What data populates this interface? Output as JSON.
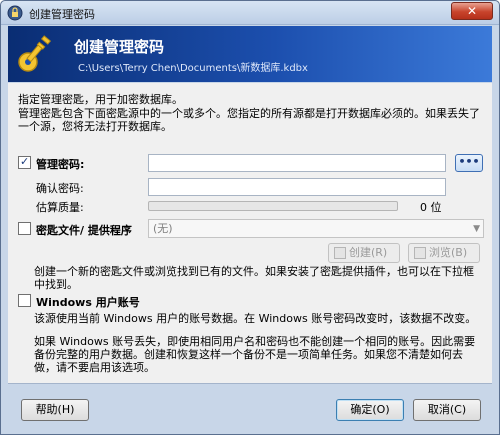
{
  "window": {
    "title": "创建管理密码"
  },
  "banner": {
    "title": "创建管理密码",
    "path": "C:\\Users\\Terry Chen\\Documents\\新数据库.kdbx"
  },
  "intro": {
    "line1": "指定管理密匙，用于加密数据库。",
    "line2": "管理密匙包含下面密匙源中的一个或多个。您指定的所有源都是打开数据库必须的。如果丢失了一个源，您将无法打开数据库。"
  },
  "password": {
    "checked": true,
    "label": "管理密码:",
    "repeat_label": "确认密码:",
    "quality_label": "估算质量:",
    "quality_value": 0,
    "quality_text": "0 位",
    "show_button_label": "•••"
  },
  "keyfile": {
    "checked": false,
    "label": "密匙文件/ 提供程序",
    "select_value": "(无)",
    "create_button": "创建(R)",
    "browse_button": "浏览(B)",
    "description": "创建一个新的密匙文件或浏览找到已有的文件。如果安装了密匙提供插件，也可以在下拉框中找到。"
  },
  "windows_account": {
    "checked": false,
    "label": "Windows 用户账号",
    "description1": "该源使用当前 Windows 用户的账号数据。在 Windows 账号密码改变时，该数据不改变。",
    "description2": "如果 Windows 账号丢失，即使用相同用户名和密码也不能创建一个相同的账号。因此需要备份完整的用户数据。创建和恢复这样一个备份不是一项简单任务。如果您不清楚如何去做，请不要启用该选项。"
  },
  "footer": {
    "help_button": "帮助(H)",
    "ok_button": "确定(O)",
    "cancel_button": "取消(C)"
  },
  "icons": {
    "title_icon": "lock-icon",
    "banner_icon": "key-icon",
    "close_icon": "close-icon"
  }
}
